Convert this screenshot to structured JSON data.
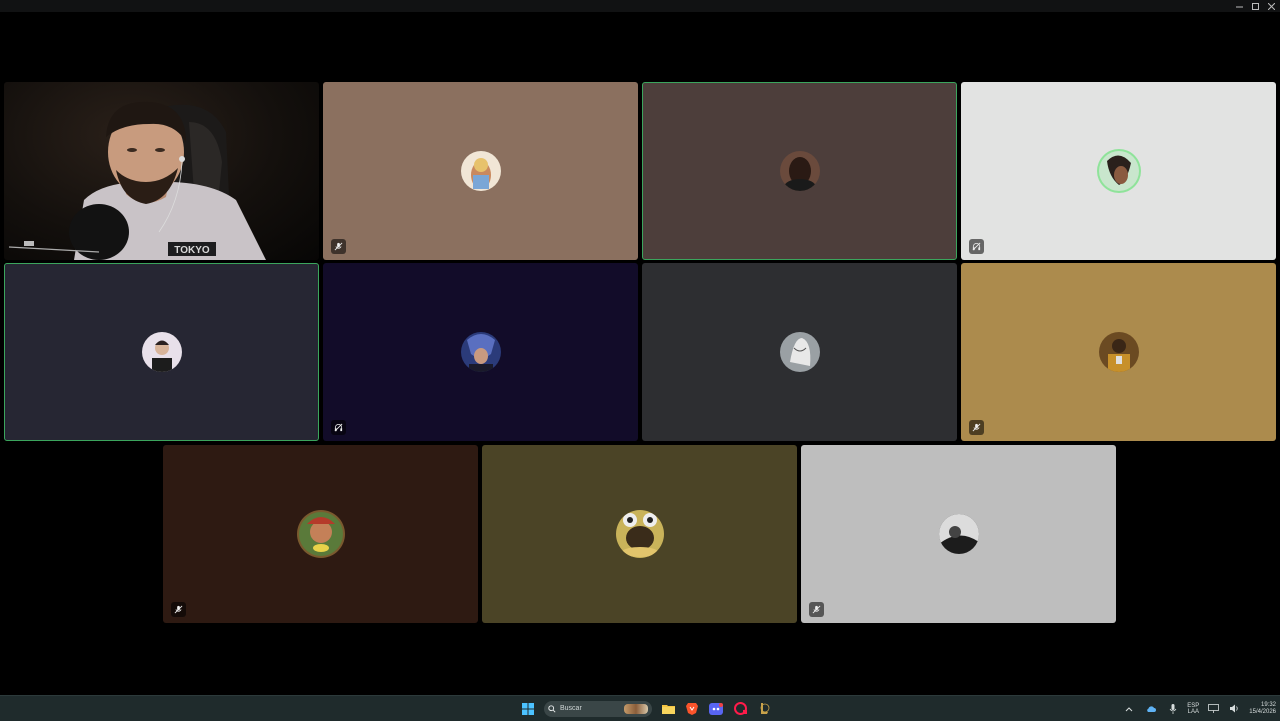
{
  "window": {
    "controls": [
      "minimize-icon",
      "maximize-icon",
      "close-icon"
    ]
  },
  "colors": {
    "speaking_border": "#3ba55d",
    "tile_backgrounds": [
      "#8b705f",
      "#4d3e3b",
      "#e2e3e2",
      "#262633",
      "#120c29",
      "#2d2e31",
      "#ac8b4d",
      "#2e1a12",
      "#4b4426",
      "#bebebe"
    ]
  },
  "tiles": [
    {
      "id": "camera",
      "video": true,
      "speaking": false,
      "status": "none"
    },
    {
      "id": "p2",
      "avatar_bg": "#f1e6d6",
      "speaking": false,
      "status": "muted-mic-icon"
    },
    {
      "id": "p3",
      "avatar_bg": "#6a4a3c",
      "speaking": true,
      "status": "none"
    },
    {
      "id": "p4",
      "avatar_bg": "#c9e6cd",
      "speaking": false,
      "status": "deafened-headset-icon"
    },
    {
      "id": "p5",
      "avatar_bg": "#e8e0ea",
      "speaking": true,
      "status": "none"
    },
    {
      "id": "p6",
      "avatar_bg": "#2b3b7a",
      "speaking": false,
      "status": "deafened-headset-icon"
    },
    {
      "id": "p7",
      "avatar_bg": "#9aa0a4",
      "speaking": false,
      "status": "none"
    },
    {
      "id": "p8",
      "avatar_bg": "#6b4a22",
      "speaking": false,
      "status": "muted-mic-icon"
    },
    {
      "id": "p9",
      "avatar_bg": "#7a5a2e",
      "speaking": false,
      "status": "muted-mic-icon"
    },
    {
      "id": "p10",
      "avatar_bg": "#c9b35a",
      "speaking": false,
      "status": "none"
    },
    {
      "id": "p11",
      "avatar_bg": "#3a3a3a",
      "speaking": false,
      "status": "muted-mic-icon"
    }
  ],
  "camera": {
    "shirt_text": "TOKYO"
  },
  "taskbar": {
    "search_placeholder": "Buscar",
    "pinned": [
      "windows-start-icon",
      "file-explorer-icon",
      "brave-browser-icon",
      "discord-icon",
      "opera-gx-icon",
      "league-of-legends-icon"
    ],
    "tray": {
      "lang_top": "ESP",
      "lang_bottom": "LAA",
      "time": "19:32",
      "date": "15/4/2026"
    }
  }
}
